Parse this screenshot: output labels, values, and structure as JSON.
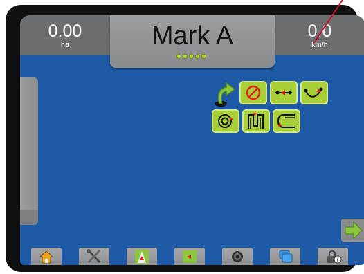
{
  "header": {
    "area": {
      "value": "0.00",
      "unit": "ha"
    },
    "title": "Mark A",
    "speed": {
      "value": "0.0",
      "unit": "km/h"
    }
  },
  "guidance_options": [
    {
      "name": "return-to-point-icon",
      "row": 0
    },
    {
      "name": "no-guidance-icon",
      "row": 0
    },
    {
      "name": "straight-ab-icon",
      "row": 0
    },
    {
      "name": "curved-ab-icon",
      "row": 0
    },
    {
      "name": "circle-pivot-icon",
      "row": 1
    },
    {
      "name": "last-pass-icon",
      "row": 1
    },
    {
      "name": "adaptive-curve-icon",
      "row": 1
    }
  ],
  "toolbar": [
    "home-icon",
    "tools-icon",
    "guidance-view-icon",
    "field-map-icon",
    "camera-icon",
    "layers-icon",
    "lock-info-icon"
  ],
  "colors": {
    "screen_bg": "#1e5aa6",
    "bar_gray": "#6d6e70",
    "accent_green": "#a9cf38",
    "marker_red": "#e2231a"
  }
}
